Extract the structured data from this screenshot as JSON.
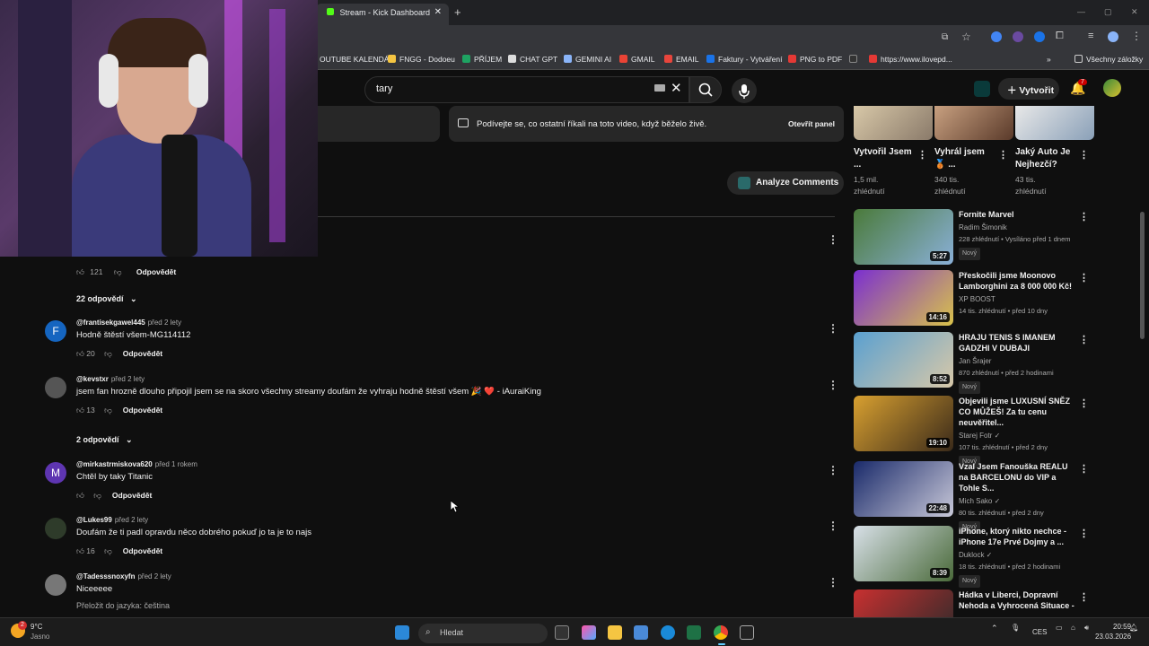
{
  "browser": {
    "tab_title": "Stream - Kick Dashboard",
    "bookmarks": [
      {
        "label": "OUTUBE KALENDÁŘ",
        "color": "#ffffff"
      },
      {
        "label": "FNGG - Dodoeu",
        "color": "#f5c542"
      },
      {
        "label": "PŘÍJEM",
        "color": "#1ea362"
      },
      {
        "label": "CHAT GPT",
        "color": "#dddddd"
      },
      {
        "label": "GEMINI AI",
        "color": "#8ab4f8"
      },
      {
        "label": "GMAIL",
        "color": "#ea4335"
      },
      {
        "label": "EMAIL",
        "color": "#e8453c"
      },
      {
        "label": "Faktury - Vytváření",
        "color": "#1a73e8"
      },
      {
        "label": "PNG to PDF",
        "color": "#e53935"
      },
      {
        "label": "",
        "color": "#333333"
      },
      {
        "label": "https://www.ilovepd...",
        "color": "#e53935"
      }
    ],
    "all_bookmarks": "Všechny záložky"
  },
  "yt": {
    "search_value": "tary",
    "create_label": "Vytvořit",
    "notif_count": "7",
    "live_chat_text": "Podívejte se, co ostatní říkali na toto video, když běželo živě.",
    "open_panel": "Otevřít panel",
    "analyze_label": "Analyze Comments"
  },
  "comments": {
    "first_reply_likes": "121",
    "reply_label": "Odpovědět",
    "first_replies": "22 odpovědí",
    "list": [
      {
        "author": "@frantisekgawel445",
        "age": "před 2 lety",
        "text": "Hodně štěstí všem-MG114112",
        "likes": "20",
        "avatar_letter": "F",
        "avatar_color": "#1565c0"
      },
      {
        "author": "@kevstxr",
        "age": "před 2 lety",
        "text": "jsem fan hrozně dlouho připojil jsem se na skoro všechny streamy doufám že vyhraju hodně štěstí všem 🎉 ❤️ - iAuraiKing",
        "likes": "13",
        "avatar_letter": "",
        "avatar_color": "#555555"
      },
      {
        "author": "@mirkastrmiskova620",
        "age": "před 1 rokem",
        "text": "Chtěl by taky Titanic",
        "likes": "",
        "avatar_letter": "M",
        "avatar_color": "#5e35b1"
      },
      {
        "author": "@Lukes99",
        "age": "před 2 lety",
        "text": "Doufám že ti padl opravdu něco dobrého pokuď jo ta je to najs",
        "likes": "16",
        "avatar_letter": "",
        "avatar_color": "#2e3b2a"
      },
      {
        "author": "@Tadesssnoxyfn",
        "age": "před 2 lety",
        "text": "Niceeeee",
        "likes": "",
        "avatar_letter": "",
        "avatar_color": "#777777"
      }
    ],
    "second_replies": "2 odpovědí",
    "translate": "Přeložit do jazyka: čeština"
  },
  "top_videos": [
    {
      "title": "Vytvořil Jsem ...",
      "meta1": "1,5 mil.",
      "meta2": "zhlédnutí"
    },
    {
      "title": "Vyhrál jsem 🥉 ...",
      "meta1": "340 tis.",
      "meta2": "zhlédnutí"
    },
    {
      "title": "Jaký Auto Je Nejhezčí?",
      "meta1": "43 tis.",
      "meta2": "zhlédnutí"
    }
  ],
  "videos": [
    {
      "title": "Fornite Marvel",
      "channel": "Radim Šimonik",
      "meta": "228 zhlédnutí • Vysíláno před 1 dnem",
      "badge": "Nový",
      "duration": "5:27",
      "c1": "#4a7a3a",
      "c2": "#8ab0d8"
    },
    {
      "title": "Přeskočili jsme Moonovo Lamborghini za 8 000 000 Kč!",
      "channel": "XP BOOST",
      "meta": "14 tis. zhlédnutí • před 10 dny",
      "badge": "",
      "duration": "14:16",
      "c1": "#7b2fd0",
      "c2": "#d9c24a"
    },
    {
      "title": "HRAJU TENIS S IMANEM GADZHI V DUBAJI",
      "channel": "Jan Šrajer",
      "meta": "870 zhlédnutí • před 2 hodinami",
      "badge": "Nový",
      "duration": "8:52",
      "c1": "#5aa0d0",
      "c2": "#d8c8a8"
    },
    {
      "title": "Objevili jsme LUXUSNÍ SNĚZ CO MŮŽEŠ! Za tu cenu neuvěřitel...",
      "channel": "Starej Fotr ✓",
      "meta": "107 tis. zhlédnutí • před 2 dny",
      "badge": "Nový",
      "duration": "19:10",
      "c1": "#d8a030",
      "c2": "#3a2a1a"
    },
    {
      "title": "Vzal Jsem Fanouška REALU na BARCELONU do VIP a Tohle S...",
      "channel": "Mich Sako ✓",
      "meta": "80 tis. zhlédnutí • před 2 dny",
      "badge": "Nový",
      "duration": "22:48",
      "c1": "#1a2a6a",
      "c2": "#c8c8d8"
    },
    {
      "title": "iPhone, ktorý nikto nechce - iPhone 17e Prvé Dojmy a ...",
      "channel": "Duklock ✓",
      "meta": "18 tis. zhlédnutí • před 2 hodinami",
      "badge": "Nový",
      "duration": "8:39",
      "c1": "#d8e0e8",
      "c2": "#4a6a3a"
    },
    {
      "title": "Hádka v Liberci, Dopravní Nehoda a Vyhrocená Situace - ...",
      "channel": "",
      "meta": "",
      "badge": "",
      "duration": "",
      "c1": "#c83030",
      "c2": "#2a2a2a"
    }
  ],
  "taskbar": {
    "weather_temp": "9°C",
    "weather_desc": "Jasno",
    "weather_badge": "2",
    "search": "Hledat",
    "lang": "CES",
    "time": "20:59",
    "date": "23.03.2026"
  }
}
